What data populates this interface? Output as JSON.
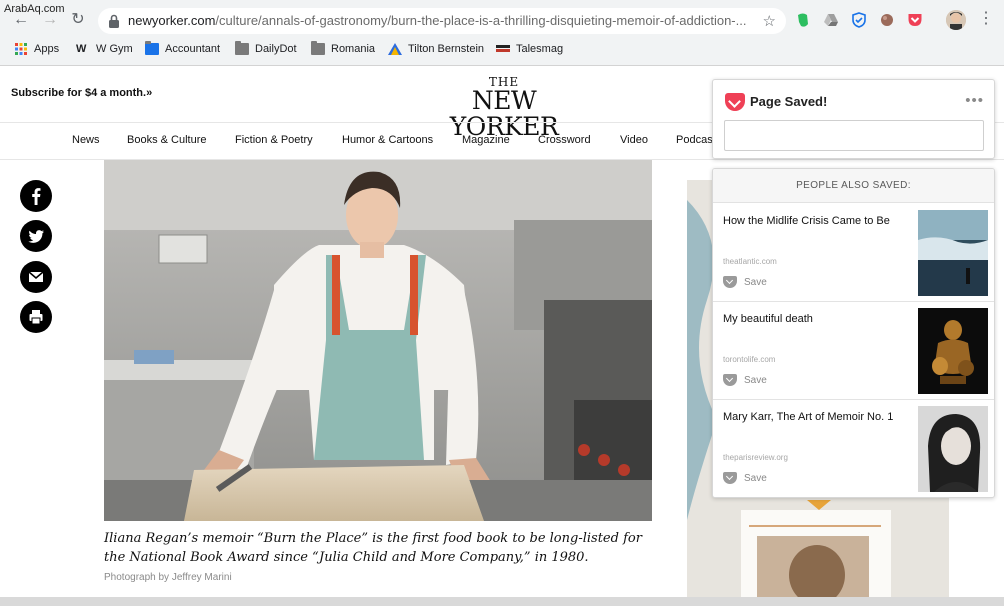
{
  "watermark": "ArabAq.com",
  "browser": {
    "url_host": "newyorker.com",
    "url_path": "/culture/annals-of-gastronomy/burn-the-place-is-a-thrilling-disquieting-memoir-of-addiction-...",
    "bookmarks": [
      {
        "label": "Apps",
        "icon": "apps-grid-icon"
      },
      {
        "label": "W Gym",
        "icon": "w-logo-icon"
      },
      {
        "label": "Accountant",
        "icon": "folder-icon"
      },
      {
        "label": "DailyDot",
        "icon": "folder-icon"
      },
      {
        "label": "Romania",
        "icon": "folder-icon"
      },
      {
        "label": "Tilton Bernstein",
        "icon": "triangle-logo-icon"
      },
      {
        "label": "Talesmag",
        "icon": "talesmag-icon"
      }
    ]
  },
  "site": {
    "subscribe": "Subscribe for $4 a month.»",
    "masthead_the": "THE",
    "masthead_name": "NEW YORKER",
    "nav": [
      "News",
      "Books & Culture",
      "Fiction & Poetry",
      "Humor & Cartoons",
      "Magazine",
      "Crossword",
      "Video",
      "Podcas"
    ]
  },
  "article": {
    "caption": "Iliana Regan’s memoir “Burn the Place” is the first food book to be long-listed for the National Book Award since “Julia Child and More Company,” in 1980.",
    "credit": "Photograph by Jeffrey Marini"
  },
  "pocket": {
    "saved_title": "Page Saved!",
    "tag_placeholder": "",
    "also_saved_header": "PEOPLE ALSO SAVED:",
    "save_label": "Save",
    "recommendations": [
      {
        "title": "How the Midlife Crisis Came to Be",
        "source": "theatlantic.com"
      },
      {
        "title": "My beautiful death",
        "source": "torontolife.com"
      },
      {
        "title": "Mary Karr, The Art of Memoir No. 1",
        "source": "theparisreview.org"
      }
    ]
  },
  "colors": {
    "pocket_red": "#ef4056",
    "chrome_bg": "#f1f3f4"
  }
}
